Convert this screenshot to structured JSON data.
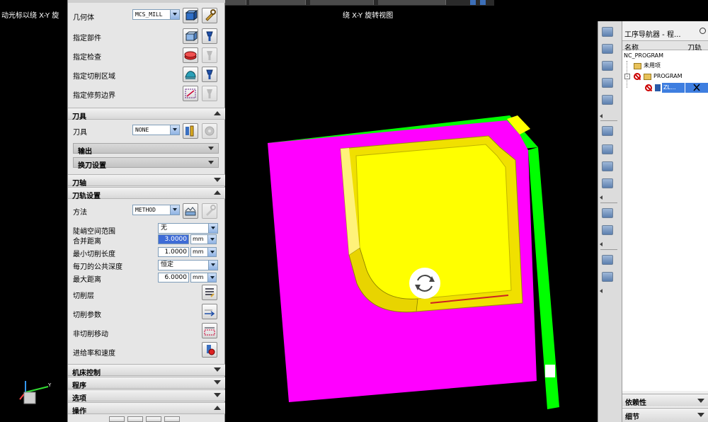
{
  "top_hint": "动光标以绕 X-Y 旋",
  "viewport_title": "绕 X-Y 旋转视图",
  "dialog": {
    "geometry": {
      "label_geometry": "几何体",
      "geometry_value": "MCS_MILL",
      "label_part": "指定部件",
      "label_check": "指定检查",
      "label_cut_area": "指定切削区域",
      "label_trim": "指定修剪边界"
    },
    "tool": {
      "header": "刀具",
      "label_tool": "刀具",
      "tool_value": "NONE",
      "output": "输出",
      "tool_change": "换刀设置"
    },
    "axis": {
      "header": "刀轴"
    },
    "path": {
      "header": "刀轨设置",
      "label_method": "方法",
      "method_value": "METHOD",
      "label_steep": "陡峭空间范围",
      "steep_value": "无",
      "label_merge": "合并距离",
      "merge_value": "3.0000",
      "merge_unit": "mm",
      "label_min_cut": "最小切削长度",
      "min_cut_value": "1.0000",
      "min_cut_unit": "mm",
      "label_depth": "每刀的公共深度",
      "depth_value": "恒定",
      "label_max_dist": "最大距离",
      "max_dist_value": "6.0000",
      "max_dist_unit": "mm",
      "label_cut_levels": "切削层",
      "label_cut_params": "切削参数",
      "label_non_cut": "非切削移动",
      "label_feeds": "进给率和速度"
    },
    "machine": {
      "header": "机床控制"
    },
    "program": {
      "header": "程序"
    },
    "options": {
      "header": "选项"
    },
    "actions": {
      "header": "操作"
    }
  },
  "navigator": {
    "title": "工序导航器 - 程...",
    "col_name": "名称",
    "col_path": "刀轨",
    "items": [
      "NC_PROGRAM",
      "未用项",
      "PROGRAM",
      "ZL..."
    ],
    "bottom1": "依赖性",
    "bottom2": "细节"
  },
  "colors": {
    "magenta": "#ff00ff",
    "green": "#00ff00",
    "yellow": "#ffff00",
    "pocket_floor": "#f0f000",
    "viewport_bg": "#000000",
    "panel_bg": "#e6e6e6"
  },
  "icons": [
    "geometry-icon",
    "edit-icon",
    "part-icon",
    "check-icon",
    "cut-area-icon",
    "trim-icon",
    "tool-icon",
    "cut-levels-icon",
    "cut-params-icon",
    "non-cut-icon",
    "feeds-icon",
    "rotate-cursor-icon",
    "axis-triad-icon"
  ]
}
